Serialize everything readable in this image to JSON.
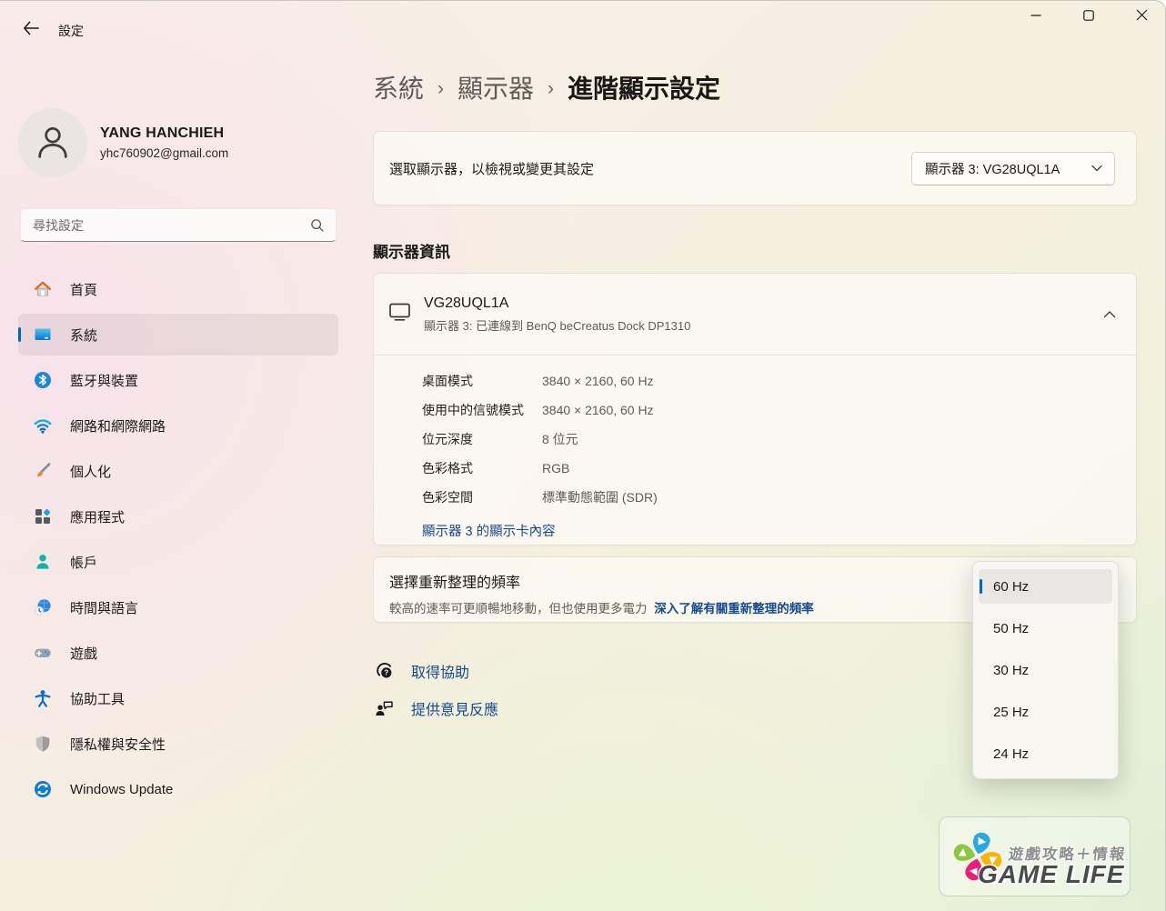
{
  "titlebar": {
    "title": "設定"
  },
  "user": {
    "name": "YANG HANCHIEH",
    "email": "yhc760902@gmail.com"
  },
  "search": {
    "placeholder": "尋找設定"
  },
  "sidebar": {
    "items": [
      {
        "id": "home",
        "label": "首頁",
        "selected": false
      },
      {
        "id": "system",
        "label": "系統",
        "selected": true
      },
      {
        "id": "bluetooth-devices",
        "label": "藍牙與裝置",
        "selected": false
      },
      {
        "id": "network-internet",
        "label": "網路和網際網路",
        "selected": false
      },
      {
        "id": "personalization",
        "label": "個人化",
        "selected": false
      },
      {
        "id": "apps",
        "label": "應用程式",
        "selected": false
      },
      {
        "id": "accounts",
        "label": "帳戶",
        "selected": false
      },
      {
        "id": "time-language",
        "label": "時間與語言",
        "selected": false
      },
      {
        "id": "gaming",
        "label": "遊戲",
        "selected": false
      },
      {
        "id": "accessibility",
        "label": "協助工具",
        "selected": false
      },
      {
        "id": "privacy-security",
        "label": "隱私權與安全性",
        "selected": false
      },
      {
        "id": "windows-update",
        "label": "Windows Update",
        "selected": false
      }
    ]
  },
  "breadcrumb": {
    "separator": "›",
    "path": [
      {
        "label": "系統"
      },
      {
        "label": "顯示器"
      }
    ],
    "current": "進階顯示設定"
  },
  "display_select": {
    "label": "選取顯示器，以檢視或變更其設定",
    "value": "顯示器 3: VG28UQL1A"
  },
  "display_info": {
    "section_title": "顯示器資訊",
    "device_name": "VG28UQL1A",
    "connection": "顯示器 3: 已連線到 BenQ beCreatus Dock DP1310",
    "properties": [
      {
        "label": "桌面模式",
        "value": "3840 × 2160, 60 Hz"
      },
      {
        "label": "使用中的信號模式",
        "value": "3840 × 2160, 60 Hz"
      },
      {
        "label": "位元深度",
        "value": "8 位元"
      },
      {
        "label": "色彩格式",
        "value": "RGB"
      },
      {
        "label": "色彩空間",
        "value": "標準動態範圍 (SDR)"
      }
    ],
    "graphics_link": "顯示器 3 的顯示卡內容"
  },
  "refresh_rate": {
    "title": "選擇重新整理的頻率",
    "description": "較高的速率可更順暢地移動，但也使用更多電力",
    "learn_more_link": "深入了解有關重新整理的頻率",
    "dropdown": {
      "selected": "60 Hz",
      "options": [
        "60 Hz",
        "50 Hz",
        "30 Hz",
        "25 Hz",
        "24 Hz"
      ]
    }
  },
  "footer": {
    "links": [
      {
        "label": "取得協助"
      },
      {
        "label": "提供意見反應"
      }
    ]
  },
  "watermark": {
    "tagline": "遊戲攻略＋情報",
    "brand": "GAME LIFE"
  },
  "colors": {
    "accent": "#0067c0",
    "link": "#17498f",
    "card_border": "#e6e1d8"
  }
}
